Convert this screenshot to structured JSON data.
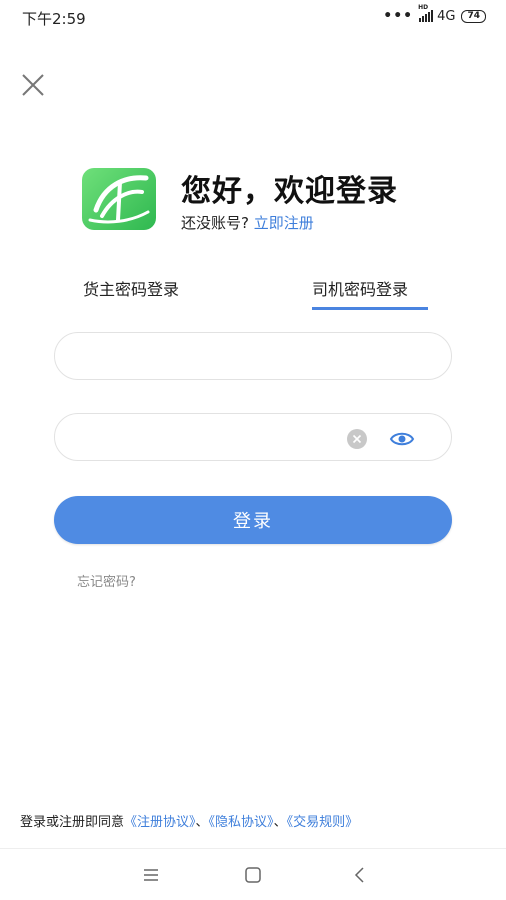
{
  "status_bar": {
    "time": "下午2:59",
    "dots": "•••",
    "hd": "HD",
    "network": "4G",
    "battery": "74"
  },
  "header": {
    "title": "您好，欢迎登录",
    "register_prompt": "还没账号?",
    "register_link": "立即注册"
  },
  "tabs": [
    {
      "label": "货主密码登录",
      "active": false
    },
    {
      "label": "司机密码登录",
      "active": true
    }
  ],
  "form": {
    "account_value": "",
    "password_value": "",
    "login_button": "登录",
    "forgot_password": "忘记密码?"
  },
  "agreement": {
    "prefix": "登录或注册即同意",
    "link1": "《注册协议》",
    "sep1": "、",
    "link2": "《隐私协议》",
    "sep2": "、",
    "link3": "《交易规则》"
  },
  "colors": {
    "accent": "#4f8be3",
    "link": "#3f7fdb",
    "logo_green": "#3cc85a"
  },
  "icons": {
    "close": "close-icon",
    "clear": "clear-icon",
    "visibility": "eye-icon",
    "menu": "menu-icon",
    "home": "home-icon",
    "back": "back-icon"
  }
}
